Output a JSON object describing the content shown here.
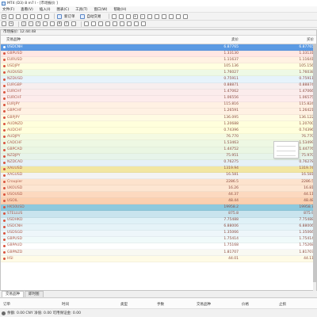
{
  "window": {
    "title": "MT4 (D3) 8 m7 l - [市场报价 ]"
  },
  "menu": [
    "文件(F)",
    "查看(V)",
    "插入(I)",
    "图表(C)",
    "工具(T)",
    "窗口(W)",
    "帮助(H)"
  ],
  "toolbar": {
    "new_order_label": "新订单",
    "auto_trade_label": "自动交易"
  },
  "watch": {
    "panel_title": "市场报价: 12:44:48",
    "columns": {
      "symbol": "交易品种",
      "bid": "卖价",
      "ask": "买价"
    },
    "rows": [
      {
        "symbol": "USDCNH",
        "bid": "6.87765",
        "ask": "6.87765",
        "bg": "#5b9ae3",
        "selected": true
      },
      {
        "symbol": "GBPUSD",
        "bid": "1.33130",
        "ask": "1.33131",
        "bg": "#ffe7e3"
      },
      {
        "symbol": "EURUSD",
        "bid": "1.11637",
        "ask": "1.11641",
        "bg": "#fff2e3"
      },
      {
        "symbol": "USDJPY",
        "bid": "105.136",
        "ask": "105.156",
        "bg": "#ffffe0"
      },
      {
        "symbol": "AUDUSD",
        "bid": "1.76027",
        "ask": "1.76038",
        "bg": "#eef9e5"
      },
      {
        "symbol": "NZDUSD",
        "bid": "0.75911",
        "ask": "0.75911",
        "bg": "#e6f3fb"
      },
      {
        "symbol": "EURGBP",
        "bid": "0.88871",
        "ask": "0.88874",
        "bg": "#f7eeee"
      },
      {
        "symbol": "EURCHF",
        "bid": "1.47062",
        "ask": "1.47066",
        "bg": "#fbecec"
      },
      {
        "symbol": "EURCHF",
        "bid": "1.06556",
        "ask": "1.06575",
        "bg": "#fdecec"
      },
      {
        "symbol": "EURJPY",
        "bid": "115.816",
        "ask": "115.824",
        "bg": "#fff1e3"
      },
      {
        "symbol": "GBPCHF",
        "bid": "1.26591",
        "ask": "1.26421",
        "bg": "#fff1e3"
      },
      {
        "symbol": "GBPJPY",
        "bid": "136.095",
        "ask": "136.122",
        "bg": "#fffbe3"
      },
      {
        "symbol": "AUDNZD",
        "bid": "1.20688",
        "ask": "1.20700",
        "bg": "#ffffdc"
      },
      {
        "symbol": "AUDCHF",
        "bid": "0.74396",
        "ask": "0.74396",
        "bg": "#ffffdc"
      },
      {
        "symbol": "AUDJPY",
        "bid": "76.770",
        "ask": "76.770",
        "bg": "#f4fae2"
      },
      {
        "symbol": "CADCHF",
        "bid": "1.53463",
        "ask": "1.53499",
        "bg": "#eef8e3"
      },
      {
        "symbol": "GBPCAD",
        "bid": "1.44752",
        "ask": "1.44776",
        "bg": "#eaf6e3"
      },
      {
        "symbol": "NZDJPY",
        "bid": "75.951",
        "ask": "75.970",
        "bg": "#e7f4ea"
      },
      {
        "symbol": "NZDCAD",
        "bid": "0.76275",
        "ask": "0.76278",
        "bg": "#e6f1f7"
      },
      {
        "symbol": "XAUUSD",
        "bid": "1319.94",
        "ask": "1319.74",
        "bg": "#f2e6a2"
      },
      {
        "symbol": "XAGUSD",
        "bid": "16.581",
        "ask": "16.581",
        "bg": "#f3f3f3"
      },
      {
        "symbol": "Croupier",
        "bid": "2286.5",
        "ask": "2286.5",
        "bg": "#fde3cd"
      },
      {
        "symbol": "UKOUSD",
        "bid": "16.26",
        "ask": "16.81",
        "bg": "#fde6d2"
      },
      {
        "symbol": "USOUSD",
        "bid": "44.37",
        "ask": "44.11",
        "bg": "#fcd9bf"
      },
      {
        "symbol": "USOIL",
        "bid": "48.44",
        "ask": "48.48",
        "bg": "#fbd0b0"
      },
      {
        "symbol": "HK50USD",
        "bid": "19958.2",
        "ask": "19958.7",
        "bg": "#8ec9dd"
      },
      {
        "symbol": "STELLUS",
        "bid": "875.8",
        "ask": "875.9",
        "bg": "#c9e4ee"
      },
      {
        "symbol": "USDHKD",
        "bid": "7.75488",
        "ask": "7.75488",
        "bg": "#dff1f7"
      },
      {
        "symbol": "USDCNH",
        "bid": "6.88006",
        "ask": "6.88006",
        "bg": "#e5f3f8"
      },
      {
        "symbol": "USDSGD",
        "bid": "1.35066",
        "ask": "1.35066",
        "bg": "#eef6fa"
      },
      {
        "symbol": "GBPUSD",
        "bid": "1.75414",
        "ask": "1.75414",
        "bg": "#f0fafa"
      },
      {
        "symbol": "GBPAUD",
        "bid": "1.75168",
        "ask": "1.75268",
        "bg": "#ffffff"
      },
      {
        "symbol": "GBPNZD",
        "bid": "1.81707",
        "ask": "1.81707",
        "bg": "#f9f9f2"
      },
      {
        "symbol": "HSI",
        "bid": "44.01",
        "ask": "44.11",
        "bg": "#fffbe6"
      }
    ]
  },
  "tabs": [
    "交易品种",
    "即时图"
  ],
  "terminal": {
    "columns": [
      "订单",
      "时间",
      "类型",
      "手数",
      "交易品种",
      "价格",
      "止损"
    ]
  },
  "status": {
    "text": "余额: 0.00 CNY  净值: 0.00  可用保证金: 0.00"
  }
}
